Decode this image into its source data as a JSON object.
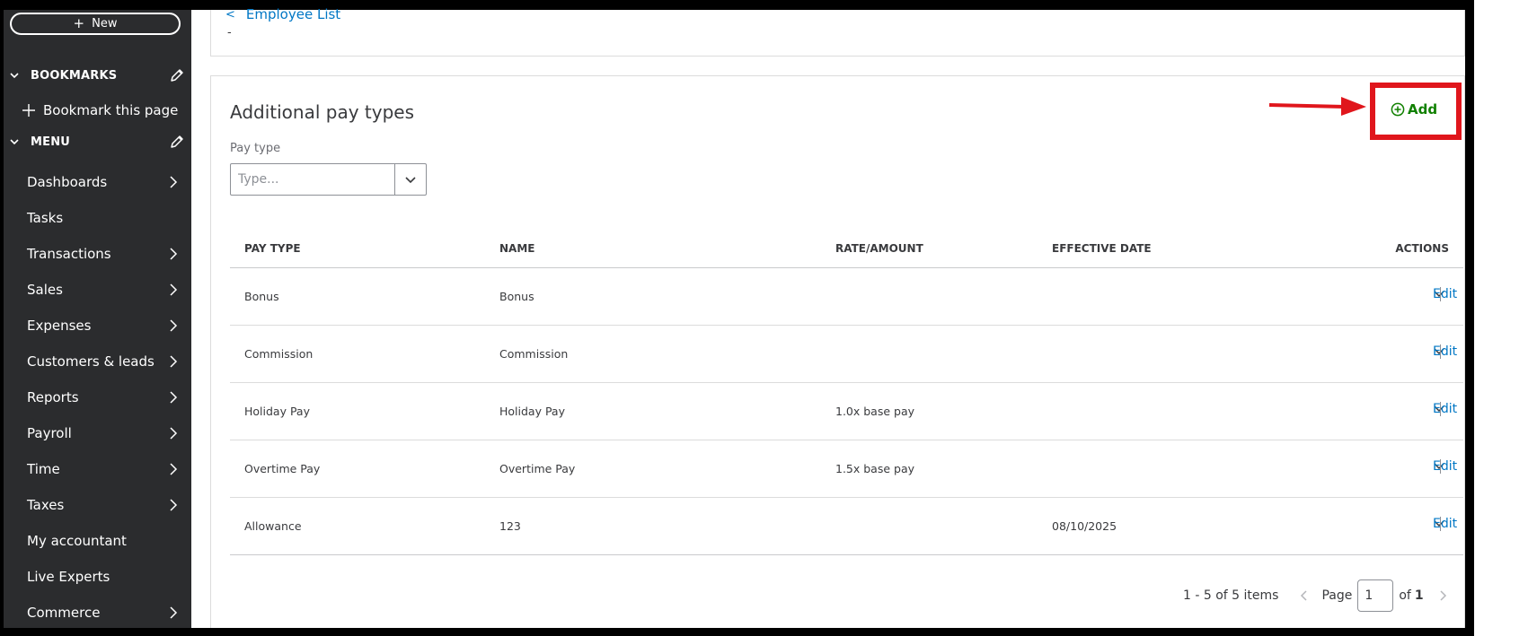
{
  "sidebar": {
    "new_label": "New",
    "bookmarks_label": "BOOKMARKS",
    "bookmark_this_page": "Bookmark this page",
    "menu_label": "MENU",
    "items": [
      {
        "label": "Dashboards",
        "has_arrow": true
      },
      {
        "label": "Tasks",
        "has_arrow": false
      },
      {
        "label": "Transactions",
        "has_arrow": true
      },
      {
        "label": "Sales",
        "has_arrow": true
      },
      {
        "label": "Expenses",
        "has_arrow": true
      },
      {
        "label": "Customers & leads",
        "has_arrow": true
      },
      {
        "label": "Reports",
        "has_arrow": true
      },
      {
        "label": "Payroll",
        "has_arrow": true
      },
      {
        "label": "Time",
        "has_arrow": true
      },
      {
        "label": "Taxes",
        "has_arrow": true
      },
      {
        "label": "My accountant",
        "has_arrow": false
      },
      {
        "label": "Live Experts",
        "has_arrow": false
      },
      {
        "label": "Commerce",
        "has_arrow": true
      }
    ]
  },
  "header": {
    "back_link": "Employee List",
    "dash": "-"
  },
  "main": {
    "title": "Additional pay types",
    "add_label": "Add",
    "pay_type_label": "Pay type",
    "pay_type_placeholder": "Type...",
    "columns": [
      "PAY TYPE",
      "NAME",
      "RATE/AMOUNT",
      "EFFECTIVE DATE",
      "ACTIONS"
    ],
    "rows": [
      {
        "pay_type": "Bonus",
        "name": "Bonus",
        "rate": "",
        "date": "",
        "action": "Edit"
      },
      {
        "pay_type": "Commission",
        "name": "Commission",
        "rate": "",
        "date": "",
        "action": "Edit"
      },
      {
        "pay_type": "Holiday Pay",
        "name": "Holiday Pay",
        "rate": "1.0x base pay",
        "date": "",
        "action": "Edit"
      },
      {
        "pay_type": "Overtime Pay",
        "name": "Overtime Pay",
        "rate": "1.5x base pay",
        "date": "",
        "action": "Edit"
      },
      {
        "pay_type": "Allowance",
        "name": "123",
        "rate": "",
        "date": "08/10/2025",
        "action": "Edit"
      }
    ],
    "pagination": {
      "summary": "1 - 5 of 5 items",
      "page_label": "Page",
      "current_page": "1",
      "of_label": "of",
      "total_pages": "1"
    }
  },
  "colors": {
    "sidebar_bg": "#2b2c2e",
    "link_blue": "#0077c5",
    "add_green": "#108000",
    "highlight_red": "#e0161c"
  }
}
